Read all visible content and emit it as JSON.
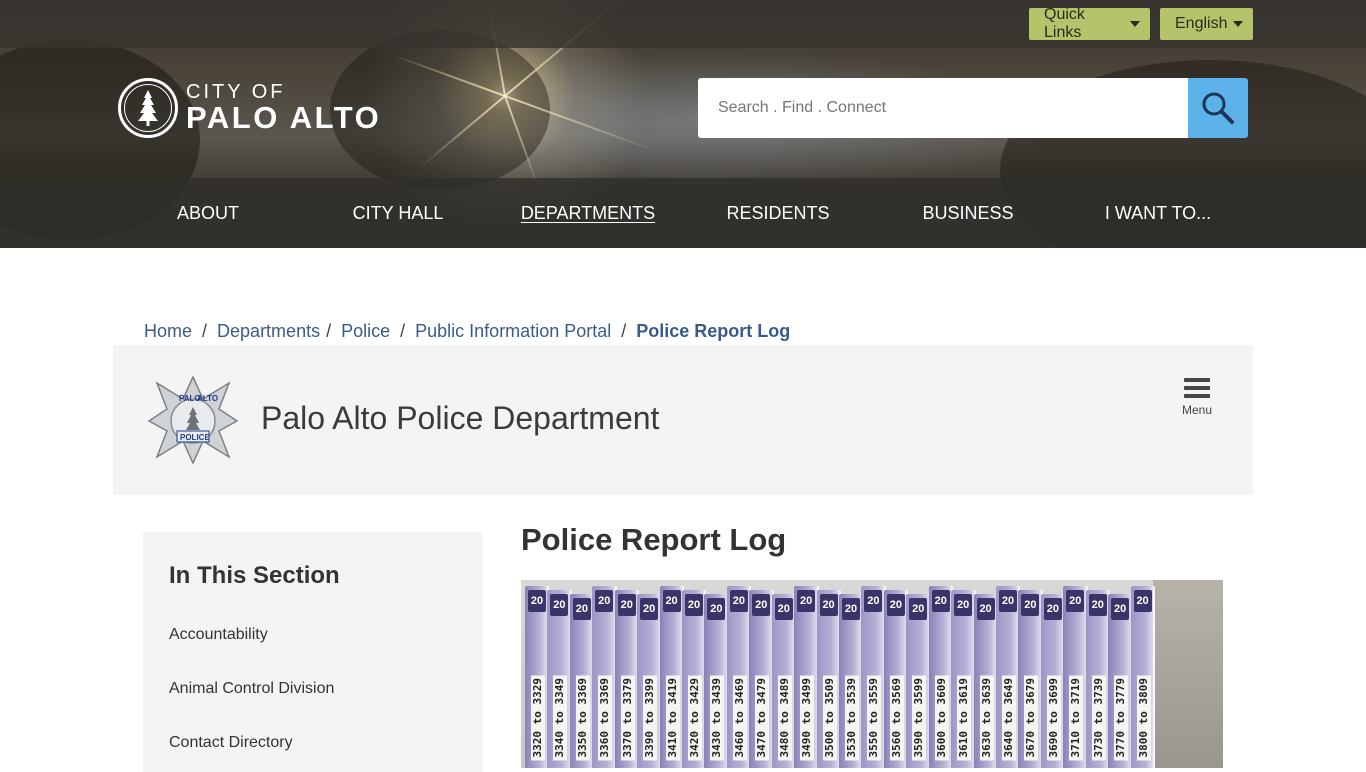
{
  "topbar": {
    "quick_links": "Quick Links",
    "language": "English"
  },
  "logo": {
    "line1": "CITY OF",
    "line2": "PALO ALTO"
  },
  "search": {
    "placeholder": "Search . Find . Connect"
  },
  "nav": {
    "items": [
      {
        "label": "ABOUT"
      },
      {
        "label": "CITY HALL"
      },
      {
        "label": "DEPARTMENTS"
      },
      {
        "label": "RESIDENTS"
      },
      {
        "label": "BUSINESS"
      },
      {
        "label": "I WANT TO..."
      }
    ]
  },
  "breadcrumb": [
    "Home",
    "Departments",
    "Police",
    "Public Information Portal",
    "Police Report Log"
  ],
  "department": {
    "title": "Palo Alto Police Department",
    "menu_label": "Menu",
    "badge_top_left": "PALO",
    "badge_top_right": "ALTO",
    "badge_bottom": "POLICE"
  },
  "sidebar": {
    "heading": "In This Section",
    "links": [
      "Accountability",
      "Animal Control Division",
      "Contact Directory"
    ]
  },
  "main": {
    "title": "Police Report Log"
  },
  "photo": {
    "tab_text": "20",
    "labels": [
      "3320 to 3329",
      "3340 to 3349",
      "3350 to 3369",
      "3360 to 3369",
      "3370 to 3379",
      "3390 to 3399",
      "3410 to 3419",
      "3420 to 3429",
      "3430 to 3439",
      "3460 to 3469",
      "3470 to 3479",
      "3480 to 3489",
      "3490 to 3499",
      "3500 to 3509",
      "3530 to 3539",
      "3550 to 3559",
      "3560 to 3569",
      "3590 to 3599",
      "3600 to 3609",
      "3610 to 3619",
      "3630 to 3639",
      "3640 to 3649",
      "3670 to 3679",
      "3690 to 3699",
      "3710 to 3719",
      "3730 to 3739",
      "3770 to 3779",
      "3800 to 3809"
    ]
  }
}
